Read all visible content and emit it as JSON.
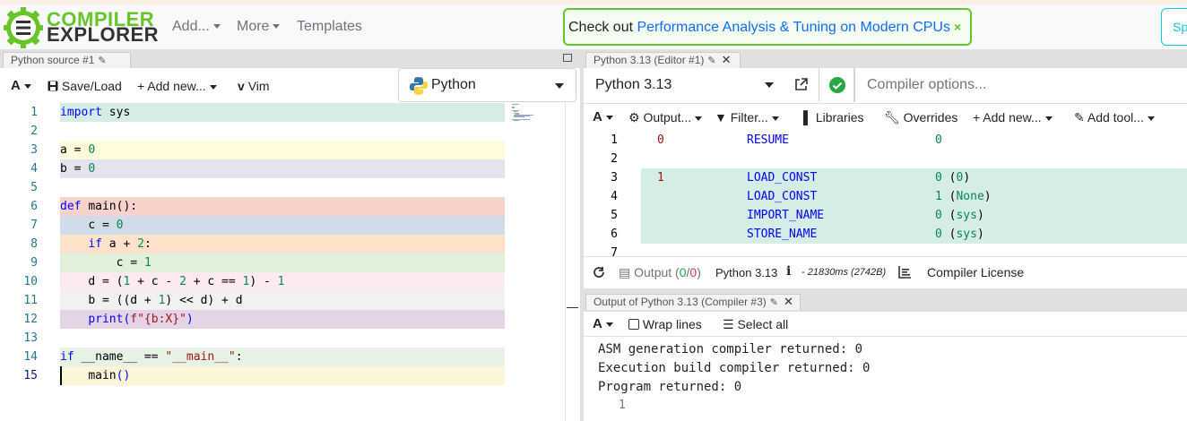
{
  "navbar": {
    "logo_line1": "COMPILER",
    "logo_line2": "EXPLORER",
    "add_label": "Add...",
    "more_label": "More",
    "templates_label": "Templates",
    "promo_prefix": "Check out ",
    "promo_link": "Performance Analysis & Tuning on Modern CPUs",
    "promo_close": "×",
    "sp_label": "Sp",
    "accent_color": "#67c52a"
  },
  "source": {
    "tab_label": "Python source #1",
    "toolbar": {
      "font_label": "A",
      "save_label": "Save/Load",
      "add_new_label": "+ Add new...",
      "vim_label": "Vim",
      "language": "Python"
    },
    "lines": [
      {
        "n": "1",
        "text": "import sys",
        "bg": "#d5ede5"
      },
      {
        "n": "2",
        "text": "",
        "bg": ""
      },
      {
        "n": "3",
        "text": "a = 0",
        "bg": "#fffbdc"
      },
      {
        "n": "4",
        "text": "b = 0",
        "bg": "#e4e3ef"
      },
      {
        "n": "5",
        "text": "",
        "bg": ""
      },
      {
        "n": "6",
        "text": "def main():",
        "bg": "#f8d1cb"
      },
      {
        "n": "7",
        "text": "    c = 0",
        "bg": "#d0dde9"
      },
      {
        "n": "8",
        "text": "    if a + 2:",
        "bg": "#fde1cb"
      },
      {
        "n": "9",
        "text": "        c = 1",
        "bg": "#e1f0d9"
      },
      {
        "n": "10",
        "text": "    d = (1 + c - 2 + c == 1) - 1",
        "bg": "#fbebf0"
      },
      {
        "n": "11",
        "text": "    b = ((d + 1) << d) + d",
        "bg": "#f1f1f1"
      },
      {
        "n": "12",
        "text": "    print(f\"{b:X}\")",
        "bg": "#e4d4e6"
      },
      {
        "n": "13",
        "text": "",
        "bg": ""
      },
      {
        "n": "14",
        "text": "if __name__ == \"__main__\":",
        "bg": "#e6f3e4"
      },
      {
        "n": "15",
        "text": "    main()",
        "bg": "#fcf6d9"
      }
    ]
  },
  "compiler": {
    "tab_label": "Python 3.13 (Editor #1)",
    "compiler_name": "Python 3.13",
    "options_placeholder": "Compiler options...",
    "toolbar": {
      "font_label": "A",
      "output_label": "Output...",
      "filter_label": "Filter...",
      "libraries_label": "Libraries",
      "overrides_label": "Overrides",
      "add_new_label": "+ Add new...",
      "add_tool_label": "Add tool..."
    },
    "asm": [
      {
        "n": "1",
        "src": "0",
        "op": "RESUME",
        "arg": "0",
        "argp": "",
        "hl": false
      },
      {
        "n": "2",
        "src": "",
        "op": "",
        "arg": "",
        "argp": "",
        "hl": false
      },
      {
        "n": "3",
        "src": "1",
        "op": "LOAD_CONST",
        "arg": "0",
        "argp": " (0)",
        "hl": true
      },
      {
        "n": "4",
        "src": "",
        "op": "LOAD_CONST",
        "arg": "1",
        "argp": " (None)",
        "hl": true
      },
      {
        "n": "5",
        "src": "",
        "op": "IMPORT_NAME",
        "arg": "0",
        "argp": " (sys)",
        "hl": true
      },
      {
        "n": "6",
        "src": "",
        "op": "STORE_NAME",
        "arg": "0",
        "argp": " (sys)",
        "hl": true
      },
      {
        "n": "7",
        "src": "",
        "op": "",
        "arg": "",
        "argp": "",
        "hl": false
      }
    ],
    "status": {
      "output_label": "Output",
      "output_count_open": " (",
      "output_ok": "0",
      "output_sep": "/",
      "output_err": "0",
      "output_count_close": ")",
      "version": "Python 3.13",
      "info_icon": "i",
      "timing": "- 21830ms (2742B)",
      "license_label": "Compiler License"
    }
  },
  "output": {
    "tab_label": "Output of Python 3.13 (Compiler #3)",
    "toolbar": {
      "font_label": "A",
      "wrap_label": "Wrap lines",
      "select_all_label": "Select all"
    },
    "lines": [
      "ASM generation compiler returned: 0",
      "Execution build compiler returned: 0",
      "Program returned: 0"
    ],
    "stdout_line_number": "1"
  }
}
